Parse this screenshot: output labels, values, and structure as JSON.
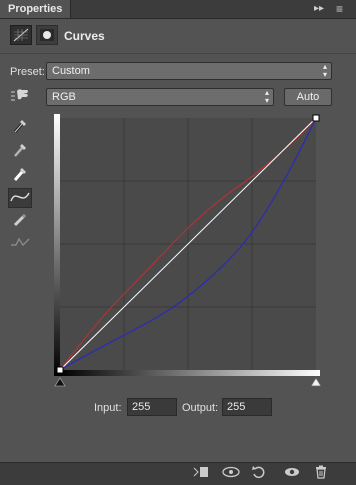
{
  "panel": {
    "tab_label": "Properties",
    "collapse_glyph": "▸▸",
    "menu_glyph": "≡"
  },
  "header": {
    "title": "Curves"
  },
  "preset": {
    "label": "Preset:",
    "value": "Custom"
  },
  "channel": {
    "value": "RGB",
    "auto_label": "Auto"
  },
  "tools": [
    "on-image-adjust-icon",
    "sample-black-point-icon",
    "sample-gray-point-icon",
    "sample-white-point-icon",
    "edit-points-curve-icon",
    "draw-curve-pencil-icon",
    "smooth-curve-icon"
  ],
  "io": {
    "input_label": "Input:",
    "input_value": "255",
    "output_label": "Output:",
    "output_value": "255"
  },
  "colors": {
    "red_curve": "#b33232",
    "blue_curve": "#2a2ab8",
    "composite_curve": "#ffffff",
    "graph_bg": "#4a4a4a"
  },
  "bottom_icons": [
    "clip-to-layer-icon",
    "view-previous-state-icon",
    "reset-icon",
    "toggle-visibility-icon",
    "delete-icon"
  ]
}
